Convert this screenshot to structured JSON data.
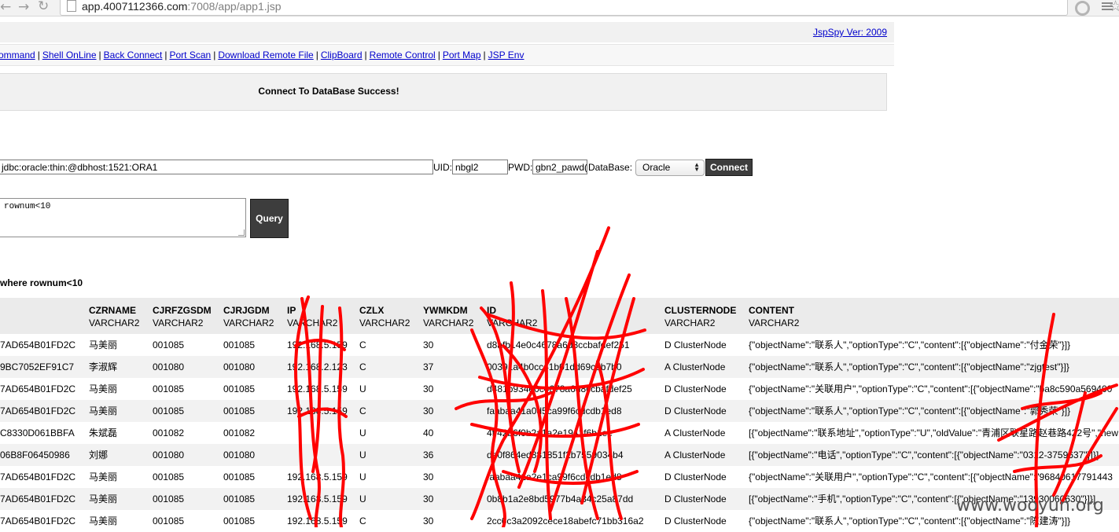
{
  "browser": {
    "back_glyph": "←",
    "forward_glyph": "→",
    "reload_glyph": "↻",
    "url_host": "app.4007112366.com",
    "url_rest": ":7008/app/app1.jsp",
    "star_glyph": "☆"
  },
  "header": {
    "version_link": "JspSpy Ver: 2009",
    "nav": [
      {
        "label": "ommand"
      },
      {
        "label": "Shell OnLine"
      },
      {
        "label": "Back Connect"
      },
      {
        "label": "Port Scan"
      },
      {
        "label": "Download Remote File"
      },
      {
        "label": "ClipBoard"
      },
      {
        "label": "Remote Control"
      },
      {
        "label": "Port Map"
      },
      {
        "label": "JSP Env"
      }
    ],
    "separator": "|"
  },
  "status": {
    "message": "Connect To DataBase Success!"
  },
  "connect_form": {
    "url_value": "jdbc:oracle:thin:@dbhost:1521:ORA1",
    "uid_label": "UID:",
    "uid_value": "nbgl2",
    "pwd_label": "PWD:",
    "pwd_value": "gbn2_pawd(",
    "db_label": "DataBase:",
    "db_selected": "Oracle",
    "connect_label": "Connect"
  },
  "query_form": {
    "sql_value": "rownum<10",
    "query_label": "Query"
  },
  "sql_info": "where rownum<10",
  "table": {
    "columns": [
      {
        "name": "CZRNAME",
        "type": "VARCHAR2"
      },
      {
        "name": "CJRFZGSDM",
        "type": "VARCHAR2"
      },
      {
        "name": "CJRJGDM",
        "type": "VARCHAR2"
      },
      {
        "name": "IP",
        "type": "VARCHAR2"
      },
      {
        "name": "CZLX",
        "type": "VARCHAR2"
      },
      {
        "name": "YWMKDM",
        "type": "VARCHAR2"
      },
      {
        "name": "ID",
        "type": "VARCHAR2"
      },
      {
        "name": "CLUSTERNODE",
        "type": "VARCHAR2"
      },
      {
        "name": "CONTENT",
        "type": "VARCHAR2"
      }
    ],
    "rows": [
      [
        "7AD654B01FD2C",
        "马美丽",
        "001085",
        "001085",
        "192.168.5.159",
        "C",
        "30",
        "d8afb14e0c4678a6d8ccbafdef251",
        "D ClusterNode",
        "{\"objectName\":\"联系人\",\"optionType\":\"C\",\"content\":[{\"objectName\":\"付金荣\"}]}"
      ],
      [
        "9BC7052EF91C7",
        "李淑辉",
        "001080",
        "001080",
        "192.168.2.123",
        "C",
        "37",
        "00391a4b0cc41b01dd69c2b7b0",
        "A ClusterNode",
        "{\"objectName\":\"联系人\",\"optionType\":\"C\",\"content\":[{\"objectName\":\"zjgtest\"}]}"
      ],
      [
        "7AD654B01FD2C",
        "马美丽",
        "001085",
        "001085",
        "192.168.5.159",
        "U",
        "30",
        "d481b934e0c4678a6d8ccbafdef25",
        "D ClusterNode",
        "{\"objectName\":\"关联用户\",\"optionType\":\"C\",\"content\":[{\"objectName\":\"ba8c590a569400"
      ],
      [
        "7AD654B01FD2C",
        "马美丽",
        "001085",
        "001085",
        "192.168.5.159",
        "C",
        "30",
        "faabaa41a0d5ca99f6cdcdb1ed8",
        "D ClusterNode",
        "{\"objectName\":\"联系人\",\"optionType\":\"C\",\"content\":[{\"objectName\":\"郭秀荣\"}]}"
      ],
      [
        "C8330D061BBFA",
        "朱斌磊",
        "001082",
        "001082",
        "",
        "U",
        "40",
        "4ff42b6f0b2a1a2e1941f6b1ee",
        "A ClusterNode",
        "[{\"objectName\":\"联系地址\",\"optionType\":\"U\",\"oldValue\":\"青浦区联星路赵巷路422号\",\"new"
      ],
      [
        "06B8F06450986",
        "刘娜",
        "001080",
        "001080",
        "",
        "U",
        "36",
        "de0f864ed881851f2b7559034b4",
        "A ClusterNode",
        "[{\"objectName\":\"电话\",\"optionType\":\"C\",\"content\":[{\"objectName\":\"0312-3759637\"}]}]"
      ],
      [
        "7AD654B01FD2C",
        "马美丽",
        "001085",
        "001085",
        "192.168.5.159",
        "U",
        "30",
        "faabaa41a2e1ca99f6cdcdb1ed8",
        "D ClusterNode",
        "{\"objectName\":\"关联用户\",\"optionType\":\"C\",\"content\":[{\"objectName\":\"96840617791443"
      ],
      [
        "7AD654B01FD2C",
        "马美丽",
        "001085",
        "001085",
        "192.168.5.159",
        "U",
        "30",
        "0b8b1a2e8bd5977b4a34c25a87dd",
        "D ClusterNode",
        "[{\"objectName\":\"手机\",\"optionType\":\"C\",\"content\":[{\"objectName\":\"13930060630\"}]}]"
      ],
      [
        "7AD654B01FD2C",
        "马美丽",
        "001085",
        "001085",
        "192.168.5.159",
        "C",
        "30",
        "2cc6c3a2092cece18abefc71bb316a2",
        "D ClusterNode",
        "{\"objectName\":\"联系人\",\"optionType\":\"C\",\"content\":[{\"objectName\":\"陈建涛\"}]}"
      ]
    ]
  },
  "watermark": "www.wooyun.org",
  "colors": {
    "link": "#0000cc",
    "scribble": "#ff0000",
    "button_dark": "#3d3d3d",
    "header_bg": "#f1f1f1"
  }
}
